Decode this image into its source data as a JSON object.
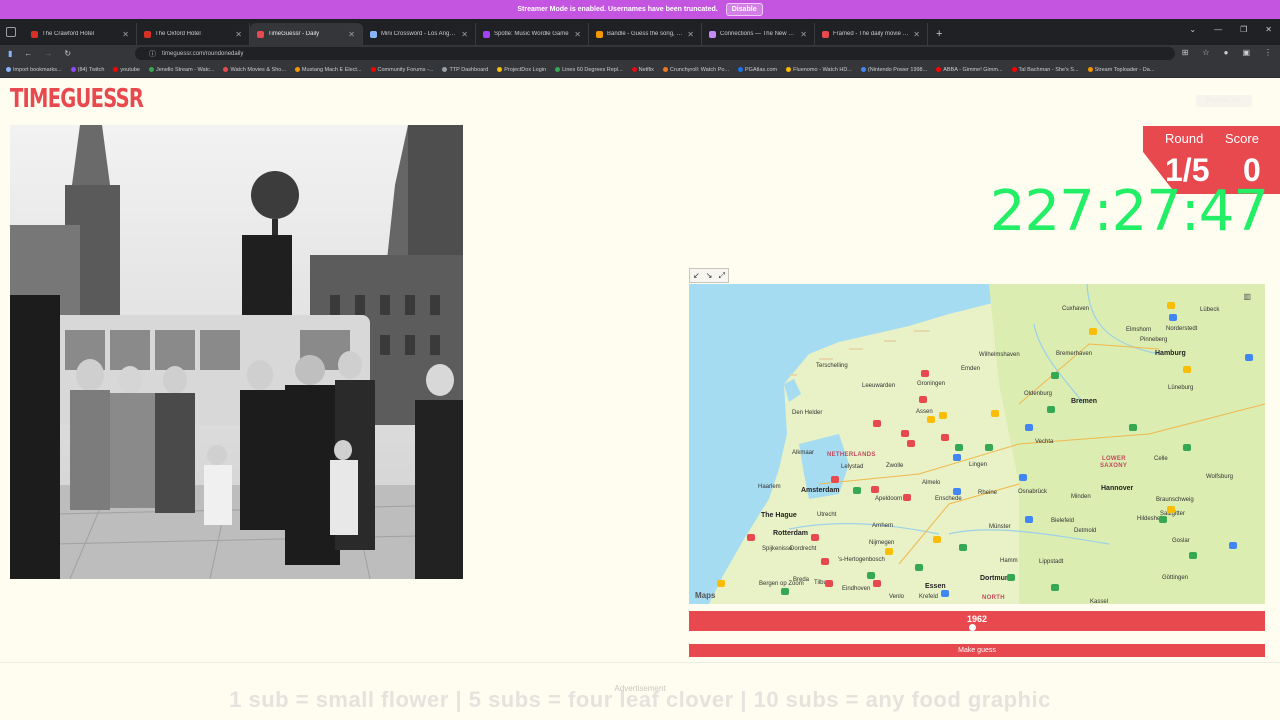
{
  "streamer_banner": {
    "message": "Streamer Mode is enabled. Usernames have been truncated.",
    "disable_label": "Disable"
  },
  "tabs": [
    {
      "title": "The Crawford Hotel",
      "color": "#d93025",
      "active": false
    },
    {
      "title": "The Oxford Hotel",
      "color": "#d93025",
      "active": false
    },
    {
      "title": "TimeGuessr - Daily",
      "color": "#e8494e",
      "active": true
    },
    {
      "title": "Mini Crossword - Los Angeles T",
      "color": "#8ab4f8",
      "active": false
    },
    {
      "title": "Spotle: Music Wordle Game",
      "color": "#a142f4",
      "active": false
    },
    {
      "title": "Bandle - Guess the song, one i",
      "color": "#f29900",
      "active": false
    },
    {
      "title": "Connections — The New York T",
      "color": "#c58af9",
      "active": false
    },
    {
      "title": "Framed - The daily movie guess",
      "color": "#e8494e",
      "active": false
    }
  ],
  "address_bar": {
    "url": "timeguessr.com/roundonedaily"
  },
  "bookmarks": [
    {
      "label": "Import bookmarks...",
      "color": "#8ab4f8"
    },
    {
      "label": "(84) Twitch",
      "color": "#9146ff"
    },
    {
      "label": "youtube",
      "color": "#ff0000"
    },
    {
      "label": "Jenello Stream - Watc...",
      "color": "#34a853"
    },
    {
      "label": "Watch Movies & Sho...",
      "color": "#e8494e"
    },
    {
      "label": "Mustang Mach E Elect...",
      "color": "#f29900"
    },
    {
      "label": "Community Forums -...",
      "color": "#ff0000"
    },
    {
      "label": "TTP Dashboard",
      "color": "#9aa0a6"
    },
    {
      "label": "ProjectDox Login",
      "color": "#fbbc04"
    },
    {
      "label": "Lines 60 Degrees Repl...",
      "color": "#34a853"
    },
    {
      "label": "Netflix",
      "color": "#e50914"
    },
    {
      "label": "Crunchyroll: Watch Po...",
      "color": "#f47521"
    },
    {
      "label": "PGAtlas.com",
      "color": "#1a73e8"
    },
    {
      "label": "Fluenomo - Watch HD...",
      "color": "#fbbc04"
    },
    {
      "label": "(Nintendo Power 1998...",
      "color": "#4285f4"
    },
    {
      "label": "ABBA - Gimme! Gimm...",
      "color": "#ff0000"
    },
    {
      "label": "Tal Bachman - She's S...",
      "color": "#ff0000"
    },
    {
      "label": "Stream Toploader - Da...",
      "color": "#f29900"
    }
  ],
  "app": {
    "logo": "TIMEGUESSR",
    "signin_label": "Remove ads",
    "round_label": "Round",
    "score_label": "Score",
    "round_value": "1/5",
    "score_value": "0",
    "timer": "227:27:47"
  },
  "map": {
    "attribution": " Maps",
    "labels": [
      {
        "text": "Hamburg",
        "kind": "major"
      },
      {
        "text": "Bremen",
        "kind": "major"
      },
      {
        "text": "Hannover",
        "kind": "major"
      },
      {
        "text": "Amsterdam",
        "kind": "major"
      },
      {
        "text": "The Hague",
        "kind": "major"
      },
      {
        "text": "Rotterdam",
        "kind": "major"
      },
      {
        "text": "Dortmund",
        "kind": "major"
      },
      {
        "text": "Essen",
        "kind": "major"
      },
      {
        "text": "NETHERLANDS",
        "kind": "region"
      },
      {
        "text": "LOWER",
        "kind": "region"
      },
      {
        "text": "SAXONY",
        "kind": "region"
      },
      {
        "text": "NORTH",
        "kind": "region"
      },
      {
        "text": "Terschelling",
        "kind": "minor"
      },
      {
        "text": "Leeuwarden",
        "kind": "minor"
      },
      {
        "text": "Groningen",
        "kind": "minor"
      },
      {
        "text": "Wilhelmshaven",
        "kind": "minor"
      },
      {
        "text": "Emden",
        "kind": "minor"
      },
      {
        "text": "Oldenburg",
        "kind": "minor"
      },
      {
        "text": "Bremerhaven",
        "kind": "minor"
      },
      {
        "text": "Cuxhaven",
        "kind": "minor"
      },
      {
        "text": "Elmshorn",
        "kind": "minor"
      },
      {
        "text": "Pinneberg",
        "kind": "minor"
      },
      {
        "text": "Norderstedt",
        "kind": "minor"
      },
      {
        "text": "Lübeck",
        "kind": "minor"
      },
      {
        "text": "Lüneburg",
        "kind": "minor"
      },
      {
        "text": "Den Helder",
        "kind": "minor"
      },
      {
        "text": "Assen",
        "kind": "minor"
      },
      {
        "text": "Alkmaar",
        "kind": "minor"
      },
      {
        "text": "Lelystad",
        "kind": "minor"
      },
      {
        "text": "Zwolle",
        "kind": "minor"
      },
      {
        "text": "Lingen",
        "kind": "minor"
      },
      {
        "text": "Vechta",
        "kind": "minor"
      },
      {
        "text": "Celle",
        "kind": "minor"
      },
      {
        "text": "Wolfsburg",
        "kind": "minor"
      },
      {
        "text": "Haarlem",
        "kind": "minor"
      },
      {
        "text": "Almelo",
        "kind": "minor"
      },
      {
        "text": "Rheine",
        "kind": "minor"
      },
      {
        "text": "Osnabrück",
        "kind": "minor"
      },
      {
        "text": "Minden",
        "kind": "minor"
      },
      {
        "text": "Braunschweig",
        "kind": "minor"
      },
      {
        "text": "Salzgitter",
        "kind": "minor"
      },
      {
        "text": "Utrecht",
        "kind": "minor"
      },
      {
        "text": "Apeldoorn",
        "kind": "minor"
      },
      {
        "text": "Enschede",
        "kind": "minor"
      },
      {
        "text": "Arnhem",
        "kind": "minor"
      },
      {
        "text": "Nijmegen",
        "kind": "minor"
      },
      {
        "text": "Münster",
        "kind": "minor"
      },
      {
        "text": "Bielefeld",
        "kind": "minor"
      },
      {
        "text": "Detmold",
        "kind": "minor"
      },
      {
        "text": "Hildesheim",
        "kind": "minor"
      },
      {
        "text": "Goslar",
        "kind": "minor"
      },
      {
        "text": "Dordrecht",
        "kind": "minor"
      },
      {
        "text": "Breda",
        "kind": "minor"
      },
      {
        "text": "Tilburg",
        "kind": "minor"
      },
      {
        "text": "Eindhoven",
        "kind": "minor"
      },
      {
        "text": "Venlo",
        "kind": "minor"
      },
      {
        "text": "Krefeld",
        "kind": "minor"
      },
      {
        "text": "Kassel",
        "kind": "minor"
      },
      {
        "text": "Göttingen",
        "kind": "minor"
      },
      {
        "text": "Hamm",
        "kind": "minor"
      },
      {
        "text": "Lippstadt",
        "kind": "minor"
      },
      {
        "text": "Bergen op Zoom",
        "kind": "minor"
      },
      {
        "text": "Spijkenisse",
        "kind": "minor"
      },
      {
        "text": "'s-Hertogenbosch",
        "kind": "minor"
      }
    ]
  },
  "year_slider": {
    "value": "1962",
    "fraction": 0.492
  },
  "guess_button_label": "Make guess",
  "footer": {
    "ad_label": "Advertisement",
    "overlay_text": "1 sub = small flower | 5 subs = four leaf clover | 10 subs = any food graphic"
  },
  "colors": {
    "brand": "#e8494e",
    "timer": "#22ee66",
    "page_bg": "#fffdf0"
  }
}
